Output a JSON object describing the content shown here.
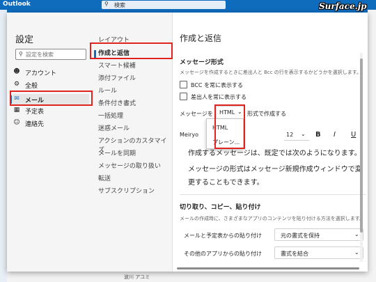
{
  "app": {
    "name": "Outlook"
  },
  "topbar": {
    "search_placeholder": "検索",
    "watermark": "Surface.jp"
  },
  "dialog": {
    "title": "設定",
    "search_placeholder": "設定を検索",
    "nav1": [
      {
        "label": "アカウント",
        "icon": "person-icon"
      },
      {
        "label": "全般",
        "icon": "gear-icon"
      },
      {
        "label": "メール",
        "icon": "mail-icon",
        "selected": true
      },
      {
        "label": "予定表",
        "icon": "calendar-icon"
      },
      {
        "label": "連絡先",
        "icon": "people-icon"
      }
    ],
    "nav2": [
      "レイアウト",
      "作成と返信",
      "スマート候補",
      "添付ファイル",
      "ルール",
      "条件付き書式",
      "一括処理",
      "迷惑メール",
      "アクションのカスタマイズ",
      "メールを同期",
      "メッセージの取り扱い",
      "転送",
      "サブスクリプション"
    ],
    "nav2_selected": "作成と返信"
  },
  "content": {
    "title": "作成と返信",
    "message_format": {
      "title": "メッセージ形式",
      "desc": "メッセージを作成するときに差出人と Bcc の行を表示するかどうかを選択します。",
      "bcc_label": "BCC を常に表示する",
      "from_label": "差出人を常に表示する",
      "compose_prefix": "メッセージを",
      "compose_suffix": "形式で作成する",
      "format_value": "HTML",
      "options": [
        "HTML",
        "プレーン..."
      ]
    },
    "toolbar": {
      "font": "Meiryo",
      "size": "12",
      "bold": "B",
      "italic": "I",
      "underline": "U"
    },
    "preview": {
      "line1": "作成するメッセージは、既定では次のようになります。",
      "line2": "メッセージの形式はメッセージ新規作成ウィンドウで変更することもできます。"
    },
    "paste": {
      "title": "切り取り、コピー、貼り付け",
      "desc": "メールの作成時に、さまざまなアプリのコンテンツを貼り付ける方法を選択します。",
      "row1_label": "メールと予定表からの貼り付け",
      "row1_value": "元の書式を保持",
      "row2_label": "その他のアプリからの貼り付け",
      "row2_value": "書式を結合"
    }
  },
  "background": {
    "bottom_text": "波川 アユミ"
  },
  "colors": {
    "accent": "#0f6cbd",
    "highlight": "#e0231f"
  }
}
